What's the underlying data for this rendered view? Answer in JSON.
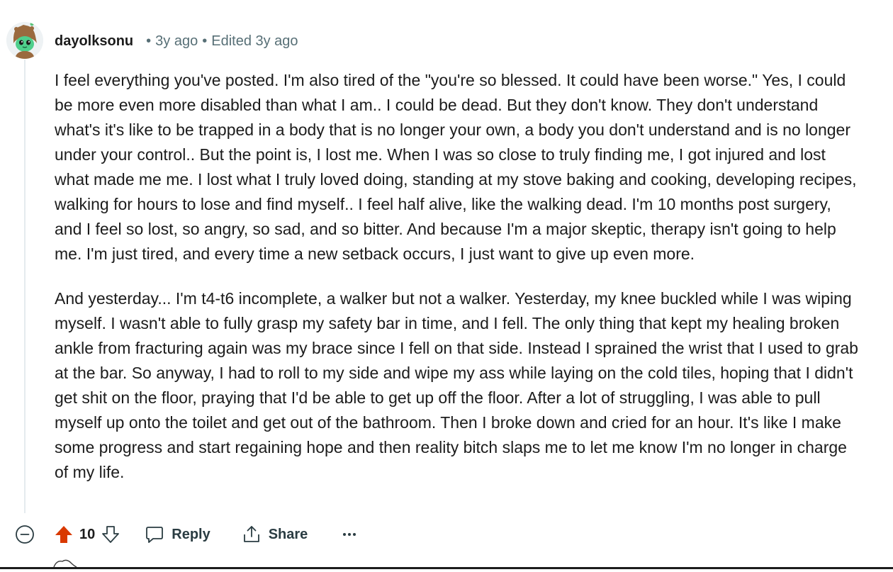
{
  "comment": {
    "username": "dayolksonu",
    "time_ago": "3y ago",
    "edited": "Edited 3y ago",
    "paragraphs": [
      "I feel everything you've posted. I'm also tired of the \"you're so blessed. It could have been worse.\" Yes, I could be more even more disabled than what I am.. I could be dead. But they don't know. They don't understand what's it's like to be trapped in a body that is no longer your own, a body you don't understand and is no longer under your control.. But the point is, I lost me. When I was so close to truly finding me, I got injured and lost what made me me. I lost what I truly loved doing, standing at my stove baking and cooking, developing recipes, walking for hours to lose and find myself.. I feel half alive, like the walking dead. I'm 10 months post surgery, and I feel so lost, so angry, so sad, and so bitter. And because I'm a major skeptic, therapy isn't going to help me. I'm just tired, and every time a new setback occurs, I just want to give up even more.",
      "And yesterday... I'm t4-t6 incomplete, a walker but not a walker. Yesterday, my knee buckled while I was wiping myself. I wasn't able to fully grasp my safety bar in time, and I fell. The only thing that kept my healing broken ankle from fracturing again was my brace since I fell on that side. Instead I sprained the wrist that I used to grab at the bar. So anyway, I had to roll to my side and wipe my ass while laying on the cold tiles, hoping that I didn't get shit on the floor, praying that I'd be able to get up off the floor. After a lot of struggling, I was able to pull myself up onto the toilet and get out of the bathroom. Then I broke down and cried for an hour. It's like I make some progress and start regaining hope and then reality bitch slaps me to let me know I'm no longer in charge of my life."
    ],
    "score": "10",
    "upvote_color": "#d93900"
  },
  "actions": {
    "reply_label": "Reply",
    "share_label": "Share",
    "more_label": "···"
  },
  "icons": {
    "collapse": "collapse-circle-minus-icon",
    "upvote": "upvote-arrow-icon",
    "downvote": "downvote-arrow-icon",
    "reply": "comment-bubble-icon",
    "share": "share-upload-icon",
    "more": "more-dots-icon"
  }
}
